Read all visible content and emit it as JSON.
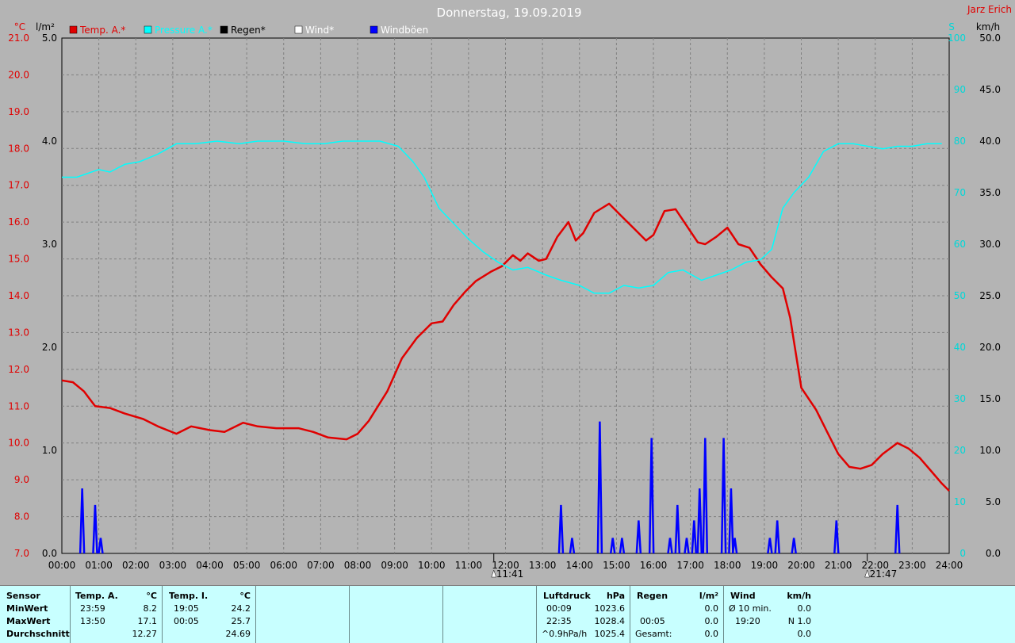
{
  "title": "Donnerstag, 19.09.2019",
  "author": "Jarz Erich",
  "legend": [
    {
      "label": "Temp. A.*",
      "color": "#e00000",
      "text_color": "#e00000"
    },
    {
      "label": "Pressure A.*",
      "color": "#00ffff",
      "text_color": "#00ffff"
    },
    {
      "label": "Regen*",
      "color": "#000000",
      "text_color": "#000000"
    },
    {
      "label": "Wind*",
      "color": "#ffffff",
      "text_color": "#ffffff"
    },
    {
      "label": "Windböen",
      "color": "#0000ff",
      "text_color": "#ffffff"
    }
  ],
  "axis_units": {
    "temp": "°C",
    "rain": "l/m²",
    "pressure": "S",
    "wind": "km/h"
  },
  "markers": [
    "11:41",
    "21:47"
  ],
  "chart_data": {
    "type": "line",
    "x_labels": [
      "00:00",
      "01:00",
      "02:00",
      "03:00",
      "04:00",
      "05:00",
      "06:00",
      "07:00",
      "08:00",
      "09:00",
      "10:00",
      "11:00",
      "12:00",
      "13:00",
      "14:00",
      "15:00",
      "16:00",
      "17:00",
      "18:00",
      "19:00",
      "20:00",
      "21:00",
      "22:00",
      "23:00",
      "24:00"
    ],
    "xlim": [
      0,
      24
    ],
    "axes": {
      "temp": {
        "ylim": [
          7.0,
          21.0
        ],
        "ticks": [
          "21.0",
          "20.0",
          "19.0",
          "18.0",
          "17.0",
          "16.0",
          "15.0",
          "14.0",
          "13.0",
          "12.0",
          "11.0",
          "10.0",
          "9.0",
          "8.0",
          "7.0"
        ]
      },
      "rain": {
        "ylim": [
          0.0,
          5.0
        ],
        "ticks": [
          "5.0",
          "4.0",
          "3.0",
          "2.0",
          "1.0",
          "0.0"
        ]
      },
      "pressure_scale": {
        "ylim": [
          0,
          100
        ],
        "ticks": [
          "100",
          "90",
          "80",
          "70",
          "60",
          "50",
          "40",
          "30",
          "20",
          "10",
          "0"
        ]
      },
      "wind": {
        "ylim": [
          0.0,
          50.0
        ],
        "ticks": [
          "50.0",
          "45.0",
          "40.0",
          "35.0",
          "30.0",
          "25.0",
          "20.0",
          "15.0",
          "10.0",
          "5.0",
          "0.0"
        ]
      }
    },
    "series": [
      {
        "name": "Temp. A.*",
        "axis": "temp",
        "color": "#e00000",
        "points": [
          [
            0,
            11.7
          ],
          [
            0.3,
            11.65
          ],
          [
            0.6,
            11.4
          ],
          [
            0.9,
            11.0
          ],
          [
            1.3,
            10.95
          ],
          [
            1.7,
            10.8
          ],
          [
            2.2,
            10.65
          ],
          [
            2.6,
            10.45
          ],
          [
            3.1,
            10.25
          ],
          [
            3.5,
            10.45
          ],
          [
            4.0,
            10.35
          ],
          [
            4.4,
            10.3
          ],
          [
            4.9,
            10.55
          ],
          [
            5.3,
            10.45
          ],
          [
            5.8,
            10.4
          ],
          [
            6.4,
            10.4
          ],
          [
            6.8,
            10.3
          ],
          [
            7.2,
            10.15
          ],
          [
            7.7,
            10.1
          ],
          [
            8.0,
            10.25
          ],
          [
            8.3,
            10.6
          ],
          [
            8.8,
            11.4
          ],
          [
            9.2,
            12.3
          ],
          [
            9.6,
            12.85
          ],
          [
            10.0,
            13.25
          ],
          [
            10.3,
            13.3
          ],
          [
            10.6,
            13.75
          ],
          [
            10.9,
            14.1
          ],
          [
            11.2,
            14.4
          ],
          [
            11.6,
            14.65
          ],
          [
            11.9,
            14.8
          ],
          [
            12.2,
            15.1
          ],
          [
            12.4,
            14.95
          ],
          [
            12.6,
            15.15
          ],
          [
            12.9,
            14.95
          ],
          [
            13.1,
            15.0
          ],
          [
            13.4,
            15.6
          ],
          [
            13.7,
            16.0
          ],
          [
            13.9,
            15.5
          ],
          [
            14.1,
            15.7
          ],
          [
            14.4,
            16.25
          ],
          [
            14.8,
            16.5
          ],
          [
            15.1,
            16.2
          ],
          [
            15.5,
            15.8
          ],
          [
            15.8,
            15.5
          ],
          [
            16.0,
            15.65
          ],
          [
            16.3,
            16.3
          ],
          [
            16.6,
            16.35
          ],
          [
            16.9,
            15.9
          ],
          [
            17.2,
            15.45
          ],
          [
            17.4,
            15.4
          ],
          [
            17.7,
            15.6
          ],
          [
            18.0,
            15.85
          ],
          [
            18.3,
            15.4
          ],
          [
            18.6,
            15.3
          ],
          [
            18.9,
            14.85
          ],
          [
            19.2,
            14.5
          ],
          [
            19.5,
            14.2
          ],
          [
            19.7,
            13.4
          ],
          [
            20.0,
            11.5
          ],
          [
            20.4,
            10.9
          ],
          [
            20.7,
            10.3
          ],
          [
            21.0,
            9.7
          ],
          [
            21.3,
            9.35
          ],
          [
            21.6,
            9.3
          ],
          [
            21.9,
            9.4
          ],
          [
            22.2,
            9.7
          ],
          [
            22.6,
            10.0
          ],
          [
            22.9,
            9.85
          ],
          [
            23.2,
            9.6
          ],
          [
            23.5,
            9.25
          ],
          [
            23.8,
            8.9
          ],
          [
            24.0,
            8.7
          ],
          [
            24.3,
            8.4
          ]
        ]
      },
      {
        "name": "Pressure A.*",
        "axis": "pressure_scale",
        "color": "#00ffff",
        "points": [
          [
            0,
            73.0
          ],
          [
            0.4,
            73.0
          ],
          [
            1.0,
            74.5
          ],
          [
            1.3,
            74.0
          ],
          [
            1.7,
            75.5
          ],
          [
            2.1,
            76.0
          ],
          [
            2.6,
            77.5
          ],
          [
            3.1,
            79.5
          ],
          [
            3.6,
            79.5
          ],
          [
            4.2,
            80.0
          ],
          [
            4.8,
            79.5
          ],
          [
            5.3,
            80.0
          ],
          [
            6.0,
            80.0
          ],
          [
            6.6,
            79.5
          ],
          [
            7.1,
            79.5
          ],
          [
            7.6,
            80.0
          ],
          [
            8.2,
            80.0
          ],
          [
            8.6,
            80.0
          ],
          [
            9.1,
            79.0
          ],
          [
            9.5,
            76.0
          ],
          [
            9.8,
            73.0
          ],
          [
            10.2,
            67.0
          ],
          [
            10.6,
            64.0
          ],
          [
            11.0,
            61.0
          ],
          [
            11.4,
            58.5
          ],
          [
            11.8,
            56.5
          ],
          [
            12.2,
            55.0
          ],
          [
            12.6,
            55.5
          ],
          [
            13.1,
            54.0
          ],
          [
            13.5,
            53.0
          ],
          [
            14.0,
            52.0
          ],
          [
            14.4,
            50.5
          ],
          [
            14.8,
            50.5
          ],
          [
            15.2,
            52.0
          ],
          [
            15.6,
            51.5
          ],
          [
            16.0,
            52.0
          ],
          [
            16.4,
            54.5
          ],
          [
            16.8,
            55.0
          ],
          [
            17.3,
            53.0
          ],
          [
            17.7,
            54.0
          ],
          [
            18.1,
            55.0
          ],
          [
            18.5,
            56.5
          ],
          [
            18.9,
            57.0
          ],
          [
            19.2,
            59.0
          ],
          [
            19.5,
            67.0
          ],
          [
            19.8,
            70.0
          ],
          [
            20.2,
            73.0
          ],
          [
            20.6,
            78.0
          ],
          [
            21.0,
            79.5
          ],
          [
            21.4,
            79.5
          ],
          [
            21.8,
            79.0
          ],
          [
            22.2,
            78.5
          ],
          [
            22.6,
            79.0
          ],
          [
            23.0,
            79.0
          ],
          [
            23.4,
            79.5
          ],
          [
            23.8,
            79.5
          ],
          [
            24.3,
            79.5
          ]
        ]
      },
      {
        "name": "Windböen",
        "axis": "wind",
        "color": "#0000ff",
        "type": "spikes",
        "points": [
          [
            0.55,
            6.3
          ],
          [
            0.9,
            4.7
          ],
          [
            1.05,
            1.5
          ],
          [
            13.5,
            4.7
          ],
          [
            13.8,
            1.5
          ],
          [
            14.55,
            12.8
          ],
          [
            14.9,
            1.5
          ],
          [
            15.15,
            1.5
          ],
          [
            15.6,
            3.2
          ],
          [
            15.95,
            11.2
          ],
          [
            16.45,
            1.5
          ],
          [
            16.65,
            4.7
          ],
          [
            16.9,
            1.5
          ],
          [
            17.1,
            3.2
          ],
          [
            17.25,
            6.3
          ],
          [
            17.4,
            11.2
          ],
          [
            17.9,
            11.2
          ],
          [
            18.1,
            6.3
          ],
          [
            18.2,
            1.5
          ],
          [
            19.15,
            1.5
          ],
          [
            19.35,
            3.2
          ],
          [
            19.8,
            1.5
          ],
          [
            20.95,
            3.2
          ],
          [
            22.6,
            4.7
          ]
        ]
      }
    ]
  },
  "stats": {
    "sensor_header": "Sensor",
    "row_labels": [
      "MinWert",
      "MaxWert",
      "Durchschnitt"
    ],
    "temp_a": {
      "header": "Temp. A.",
      "unit": "°C",
      "rows": [
        [
          "23:59",
          "8.2"
        ],
        [
          "13:50",
          "17.1"
        ],
        [
          "",
          "12.27"
        ]
      ]
    },
    "temp_i": {
      "header": "Temp. I.",
      "unit": "°C",
      "rows": [
        [
          "19:05",
          "24.2"
        ],
        [
          "00:05",
          "25.7"
        ],
        [
          "",
          "24.69"
        ]
      ]
    },
    "pressure": {
      "header": "Luftdruck",
      "unit": "hPa",
      "rows": [
        [
          "00:09",
          "1023.6"
        ],
        [
          "22:35",
          "1028.4"
        ],
        [
          "^0.9hPa/h",
          "1025.4"
        ]
      ]
    },
    "rain": {
      "header": "Regen",
      "unit": "l/m²",
      "rows": [
        [
          "",
          ""
        ],
        [
          "00:05",
          "0.0"
        ],
        [
          "Gesamt:",
          "0.0"
        ]
      ],
      "row0_value": "0.0"
    },
    "wind": {
      "header": "Wind",
      "unit": "km/h",
      "rows": [
        [
          "Ø 10 min.",
          "0.0"
        ],
        [
          "19:20",
          "N 1.0"
        ],
        [
          "",
          "0.0"
        ]
      ]
    }
  }
}
